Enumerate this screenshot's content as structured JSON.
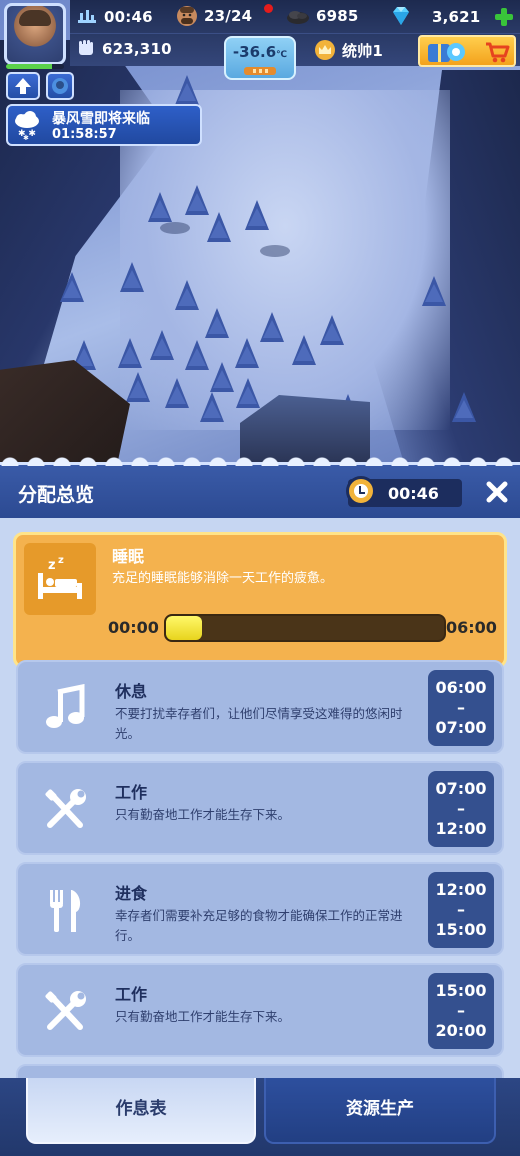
{
  "hud": {
    "clock_time": "00:46",
    "population": "23/24",
    "coal": "6985",
    "gems": "3,621",
    "power": "623,310",
    "temperature": "-36.6",
    "temperature_unit": "℃",
    "rank": "统帅1"
  },
  "event": {
    "title": "暴风雪即将来临",
    "countdown": "01:58:57"
  },
  "panel": {
    "title": "分配总览",
    "timer": "00:46"
  },
  "active_schedule": {
    "title": "睡眠",
    "description": "充足的睡眠能够消除一天工作的疲惫。",
    "start": "00:00",
    "end": "06:00",
    "progress_fraction": 0.13
  },
  "schedule": [
    {
      "icon": "music-note-icon",
      "title": "休息",
      "description": "不要打扰幸存者们，让他们尽情享受这难得的悠闲时光。",
      "start": "06:00",
      "dash": "–",
      "end": "07:00"
    },
    {
      "icon": "tools-icon",
      "title": "工作",
      "description": "只有勤奋地工作才能生存下来。",
      "start": "07:00",
      "dash": "–",
      "end": "12:00"
    },
    {
      "icon": "fork-knife-icon",
      "title": "进食",
      "description": "幸存者们需要补充足够的食物才能确保工作的正常进行。",
      "start": "12:00",
      "dash": "–",
      "end": "15:00"
    },
    {
      "icon": "tools-icon",
      "title": "工作",
      "description": "只有勤奋地工作才能生存下来。",
      "start": "15:00",
      "dash": "–",
      "end": "20:00"
    }
  ],
  "tabs": {
    "schedule": "作息表",
    "resources": "资源生产"
  },
  "colors": {
    "accent_gold": "#f4b24e",
    "panel_blue": "#2c4a92",
    "card_blue": "#a3b8e2",
    "progress_yellow": "#fff86a"
  }
}
